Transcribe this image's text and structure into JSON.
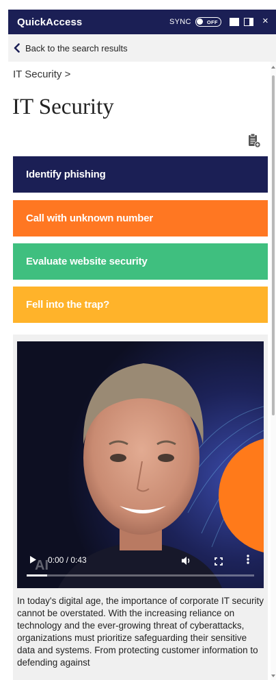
{
  "window": {
    "title": "QuickAccess",
    "sync_label": "SYNC",
    "sync_state": "OFF",
    "close_glyph": "×",
    "colors": {
      "title_bar": "#1b1f55"
    }
  },
  "nav": {
    "back_label": "Back to the search results",
    "back_icon": "chevron-left-icon"
  },
  "breadcrumb": {
    "text": "IT Security >"
  },
  "page": {
    "title": "IT Security",
    "clipboard_icon": "clipboard-add-icon"
  },
  "categories": [
    {
      "label": "Identify phishing",
      "color": "#1b1f55"
    },
    {
      "label": "Call with unknown number",
      "color": "#ff7722"
    },
    {
      "label": "Evaluate website security",
      "color": "#3fbf7f"
    },
    {
      "label": "Fell into the trap?",
      "color": "#ffb32a"
    }
  ],
  "video": {
    "time": "0:00 / 0:43",
    "progress": 0.09,
    "watermark": "AI",
    "icons": [
      "play-icon",
      "volume-icon",
      "fullscreen-icon",
      "more-options-icon"
    ]
  },
  "description": "In today's digital age, the importance of corporate IT security cannot be overstated. With the increasing reliance on technology and the ever-growing threat of cyberattacks, organizations must prioritize safeguarding their sensitive data and systems. From protecting customer information to defending against"
}
